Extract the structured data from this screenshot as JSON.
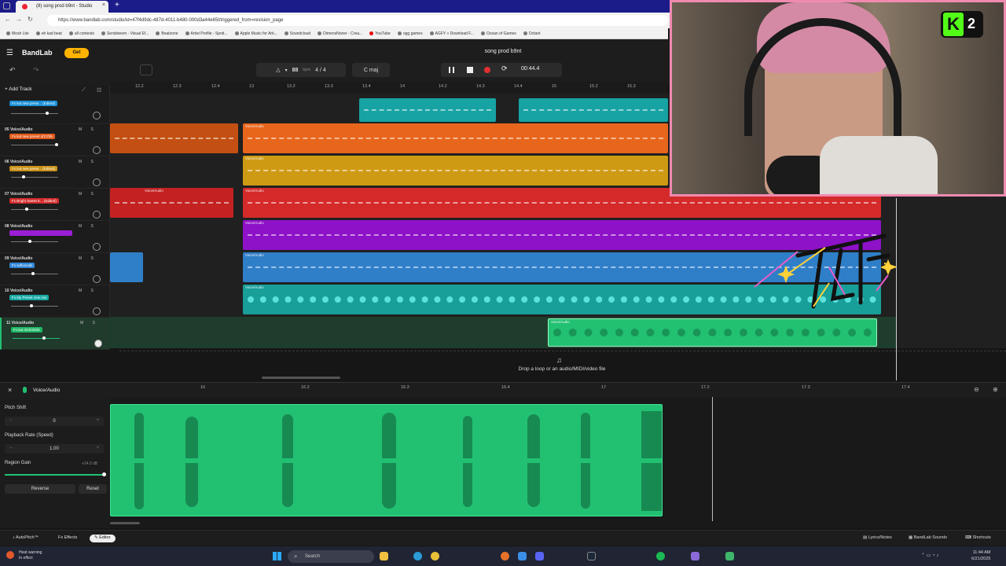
{
  "browser": {
    "tab_title": "(8) song prod b9nt - Studio",
    "url": "https://www.bandlab.com/studio/id=47f4d9dc-487d-4011-b480-000d3a44e65t/triggered_from=revision_page",
    "bookmarks": [
      "Mosh Lite",
      "eh kad beat",
      "all contests",
      "Sendsteem - Visual Ef...",
      "Beatzone",
      "Artist Profile - Spoti...",
      "Apple Music for Arti...",
      "Soundcloud",
      "DimensNoner - Crea...",
      "YouTube",
      "ogg games",
      "AGFY » Download F...",
      "Ocean of Games",
      "Octant"
    ]
  },
  "header": {
    "logo": "BandLab",
    "get_label": "Get",
    "song_title": "song prod b9nt",
    "bpm": "88",
    "bpm_unit": "bpm",
    "time_sig": "4 / 4",
    "key": "C maj",
    "time": "00:44.4"
  },
  "tracklist": {
    "add_track_label": "Add Track",
    "tracks": [
      {
        "name": "",
        "fx": "Fx kut new prese... (Edited)",
        "fx_color": "#1a8fd6"
      },
      {
        "name": "05 Voice/Audio",
        "fx": "Fx kut new preset 4/17/25",
        "fx_color": "#e15a1c"
      },
      {
        "name": "06 Voice/Audio",
        "fx": "Fx kut new prese... (Edited)",
        "fx_color": "#c99016"
      },
      {
        "name": "07 Voice/Audio",
        "fx": "Fx Bright Sweet K... (Edited)",
        "fx_color": "#d22d2d"
      },
      {
        "name": "08 Voice/Audio",
        "fx": "",
        "fx_color": "#9b1ed6"
      },
      {
        "name": "09 Voice/Audio",
        "fx": "Fx softvocals",
        "fx_color": "#2f86d8"
      },
      {
        "name": "10 Voice/Audio",
        "fx": "Fx My Preset new mix",
        "fx_color": "#16a8a4"
      },
      {
        "name": "11 Voice/Audio",
        "fx": "Fx kut 4/10/2025",
        "fx_color": "#1fb865"
      }
    ],
    "ms_label": "M S"
  },
  "timeline": {
    "ruler_ticks": [
      "12.2",
      "12.3",
      "12.4",
      "13",
      "13.2",
      "13.3",
      "13.4",
      "14",
      "14.2",
      "14.3",
      "14.4",
      "15",
      "15.2",
      "15.3"
    ],
    "region_label": "Voice/Audio",
    "drop_text": "Drop a loop or an audio/MIDI/video file"
  },
  "editor": {
    "title": "Voice/Audio",
    "ruler_ticks": [
      "16",
      "16.2",
      "16.3",
      "16.4",
      "17",
      "17.2",
      "17.3",
      "17.4"
    ],
    "pitch_shift_label": "Pitch Shift",
    "pitch_shift_value": "0",
    "playback_rate_label": "Playback Rate (Speed)",
    "playback_rate_value": "1.00",
    "region_gain_label": "Region Gain",
    "region_gain_value": "+24.0 dB",
    "reverse_label": "Reverse",
    "reset_label": "Reset"
  },
  "bottombar": {
    "autopitch": "AutoPitch™",
    "effects": "Effects",
    "editor": "Editor",
    "lyrics": "Lyrics/Notes",
    "sounds": "BandLab Sounds",
    "shortcuts": "Shortcuts"
  },
  "taskbar": {
    "weather_line1": "Heat warning",
    "weather_line2": "In effect",
    "search": "Search",
    "time": "11:44 AM",
    "date": "6/21/2025"
  },
  "webcam": {
    "badge_number": "2"
  },
  "colors": {
    "orange": "#e8661c",
    "gold": "#cf9a13",
    "red": "#d42a2a",
    "purple": "#8d12c8",
    "blue": "#2f7fc8",
    "teal": "#199f9a",
    "green": "#22c172",
    "accent_yellow": "#ffb300"
  }
}
